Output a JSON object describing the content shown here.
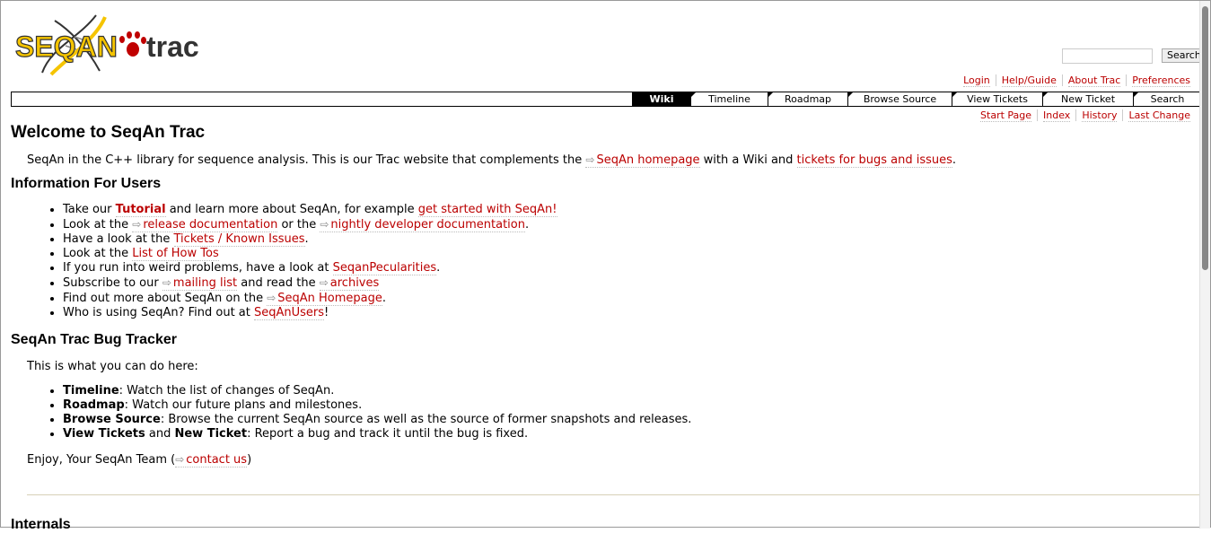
{
  "logo": {
    "text_left": "SEQAN",
    "text_right": "trac"
  },
  "search": {
    "placeholder": "",
    "button": "Search"
  },
  "metanav": [
    "Login",
    "Help/Guide",
    "About Trac",
    "Preferences"
  ],
  "mainnav": [
    "Wiki",
    "Timeline",
    "Roadmap",
    "Browse Source",
    "View Tickets",
    "New Ticket",
    "Search"
  ],
  "ctxtnav": [
    "Start Page",
    "Index",
    "History",
    "Last Change"
  ],
  "content": {
    "title": "Welcome to SeqAn Trac",
    "intro": {
      "t1": "SeqAn in the C++ library for sequence analysis. This is our Trac website that complements the ",
      "link1": "SeqAn homepage",
      "t2": " with a Wiki and ",
      "link2": "tickets for bugs and issues",
      "t3": "."
    },
    "users_heading": "Information For Users",
    "users": {
      "i1": {
        "t1": "Take our ",
        "bold_link": "Tutorial",
        "t2": " and learn more about SeqAn, for example ",
        "link": "get started with SeqAn!"
      },
      "i2": {
        "t1": "Look at the ",
        "link1": "release documentation",
        "t2": " or the ",
        "link2": "nightly developer documentation",
        "t3": "."
      },
      "i3": {
        "t1": "Have a look at the ",
        "link": "Tickets / Known Issues",
        "t2": "."
      },
      "i4": {
        "t1": "Look at the ",
        "link": "List of How Tos"
      },
      "i5": {
        "t1": "If you run into weird problems, have a look at ",
        "link": "SeqanPecularities",
        "t2": "."
      },
      "i6": {
        "t1": "Subscribe to our ",
        "link1": "mailing list",
        "t2": " and read the ",
        "link2": "archives"
      },
      "i7": {
        "t1": "Find out more about SeqAn on the ",
        "link": "SeqAn Homepage",
        "t2": "."
      },
      "i8": {
        "t1": "Who is using SeqAn? Find out at ",
        "link": "SeqAnUsers",
        "t2": "!"
      }
    },
    "tracker_heading": "SeqAn Trac Bug Tracker",
    "tracker_intro": "This is what you can do here:",
    "tracker": {
      "i1": {
        "b": "Timeline",
        "t": ": Watch the list of changes of SeqAn."
      },
      "i2": {
        "b": "Roadmap",
        "t": ": Watch our future plans and milestones."
      },
      "i3": {
        "b": "Browse Source",
        "t": ": Browse the current SeqAn source as well as the source of former snapshots and releases."
      },
      "i4": {
        "b1": "View Tickets",
        "and": " and ",
        "b2": "New Ticket",
        "t": ": Report a bug and track it until the bug is fixed."
      }
    },
    "enjoy": {
      "t1": "Enjoy, Your SeqAn Team (",
      "link": "contact us",
      "t2": ")"
    },
    "next_heading": "Internals"
  },
  "colors": {
    "link": "#bb0000",
    "logo_yellow": "#f5c400",
    "nav_active": "#000000",
    "hr": "#d7d0b7"
  }
}
